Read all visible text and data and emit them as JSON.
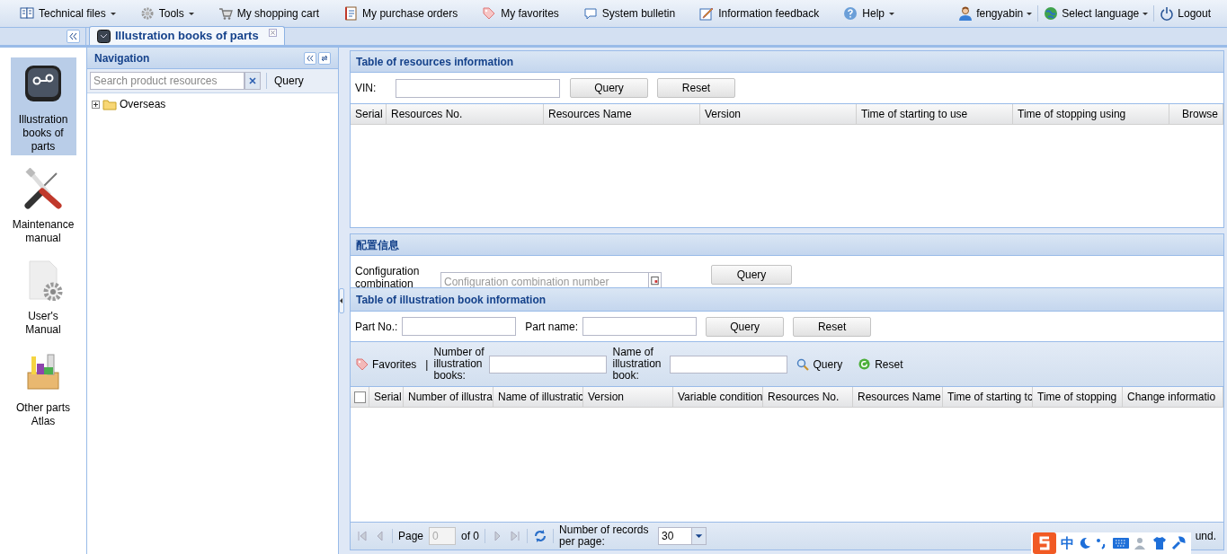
{
  "menu": [
    {
      "label": "Technical files",
      "dropdown": true
    },
    {
      "label": "Tools",
      "dropdown": true
    },
    {
      "label": "My shopping cart",
      "dropdown": false
    },
    {
      "label": "My purchase orders",
      "dropdown": false
    },
    {
      "label": "My favorites",
      "dropdown": false
    },
    {
      "label": "System bulletin",
      "dropdown": false
    },
    {
      "label": "Information feedback",
      "dropdown": false
    },
    {
      "label": "Help",
      "dropdown": true
    }
  ],
  "user_menu": [
    {
      "label": "fengyabin",
      "dropdown": true
    },
    {
      "label": "Select language",
      "dropdown": true
    },
    {
      "label": "Logout",
      "dropdown": false
    }
  ],
  "tabs": [
    {
      "label": "Illustration books of parts",
      "selected": true
    }
  ],
  "sidebar": {
    "items": [
      {
        "label": "Illustration books of parts",
        "selected": true
      },
      {
        "label": "Maintenance manual",
        "selected": false
      },
      {
        "label": "User's Manual",
        "selected": false
      },
      {
        "label": "Other parts Atlas",
        "selected": false
      }
    ]
  },
  "navigation": {
    "title": "Navigation",
    "search_placeholder": "Search product resources",
    "query": "Query",
    "tree": [
      {
        "label": "Overseas",
        "expanded": false
      }
    ]
  },
  "resources_panel": {
    "title": "Table of resources information",
    "vin_label": "VIN:",
    "buttons": [
      "Query",
      "Reset"
    ],
    "columns": [
      "Serial",
      "Resources No.",
      "Resources Name",
      "Version",
      "Time of starting to use",
      "Time of stopping using",
      "Browse"
    ]
  },
  "config_panel": {
    "title": "配置信息",
    "label": "Configuration combination",
    "placeholder": "Configuration combination number",
    "button": "Query"
  },
  "illustration_panel": {
    "title": "Table of illustration book information",
    "filters": [
      {
        "label": "Part No.:"
      },
      {
        "label": "Part name:"
      }
    ],
    "buttons": [
      "Query",
      "Reset"
    ],
    "toolbar": {
      "favorites": "Favorites",
      "separator": "|",
      "number_label": "Number of illustration books:",
      "name_label": "Name of illustration book:",
      "query": "Query",
      "reset": "Reset"
    },
    "select_all": {
      "checked": false
    },
    "columns": [
      "Serial",
      "Number of illustra",
      "Name of illustratic",
      "Version",
      "Variable condition",
      "Resources No.",
      "Resources Name",
      "Time of starting tc",
      "Time of stopping",
      "Change informatio"
    ],
    "pager": {
      "page_label": "Page",
      "page_value": "0",
      "of": "of 0",
      "records_label": "Number of records per page:",
      "per_page": "30",
      "status": "und."
    }
  },
  "ime_toolbar": {
    "mode": "中"
  }
}
